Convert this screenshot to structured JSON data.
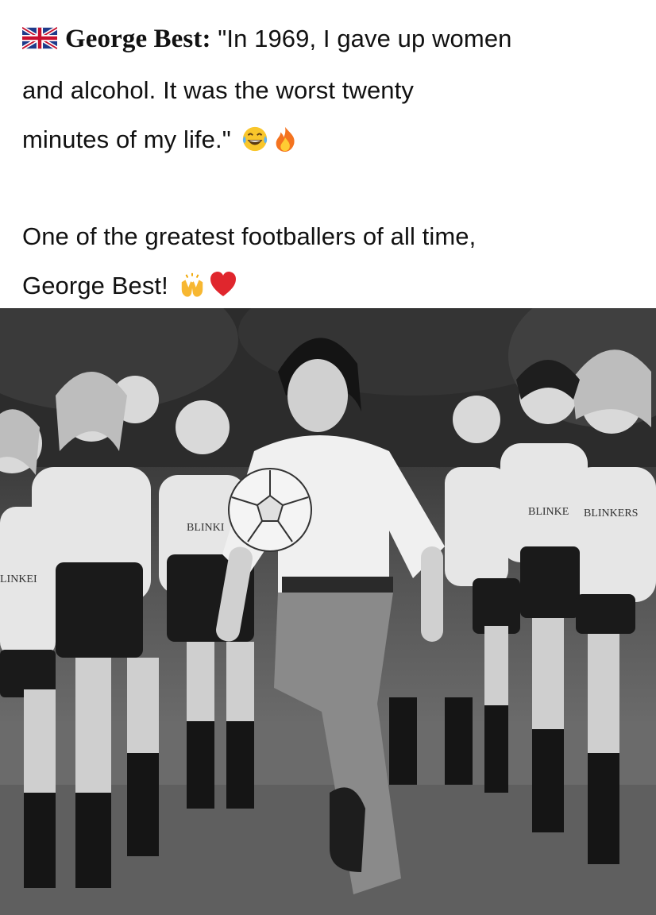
{
  "post": {
    "author_flag_icon": "uk-flag-icon",
    "author_name": "George Best",
    "colon": ":",
    "quote_line1": " \"In 1969, I gave up women",
    "quote_line2": "and alcohol. It was the worst twenty",
    "quote_line3": "minutes of my life.\"",
    "quote_emojis": [
      "face-with-tears-of-joy-icon",
      "fire-icon"
    ],
    "tribute_line1": "One of the greatest footballers of all time,",
    "tribute_line2": "George Best!",
    "tribute_emojis": [
      "raising-hands-icon",
      "red-heart-icon"
    ]
  },
  "photo": {
    "alt": "Black-and-white photo of a footballer juggling a ball surrounded by a line of women in matching T-shirts and shorts",
    "shirt_text": "BLINKERS"
  }
}
